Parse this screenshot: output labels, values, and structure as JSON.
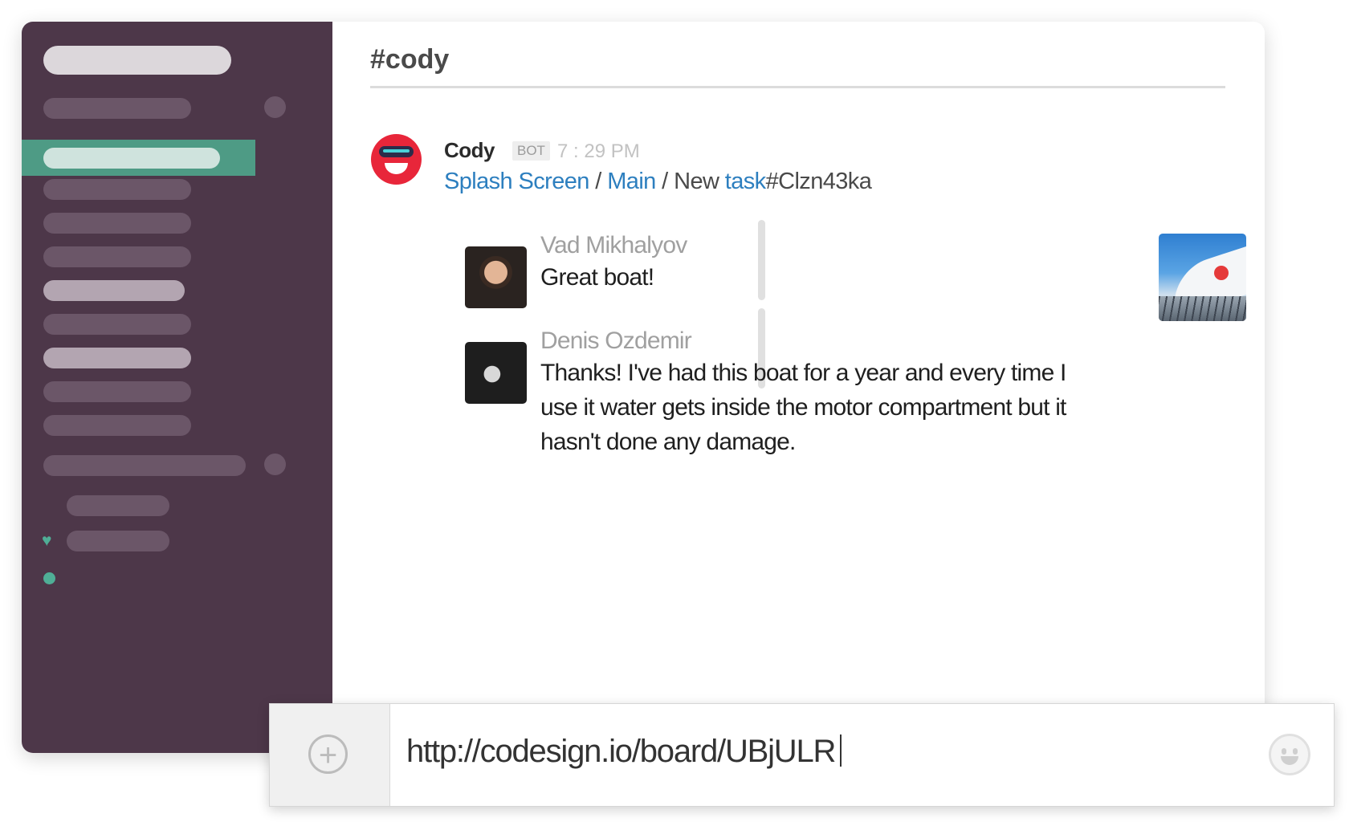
{
  "channel": {
    "name": "#cody"
  },
  "message": {
    "author": "Cody",
    "badge": "BOT",
    "time": "7 : 29 PM",
    "breadcrumb": {
      "link1": "Splash Screen",
      "sep1": "/",
      "link2": "Main",
      "sep2": "/",
      "plain": "New",
      "link3": "task",
      "task_id": "#Clzn43ka"
    },
    "replies": [
      {
        "name": "Vad Mikhalyov",
        "text": "Great boat!"
      },
      {
        "name": "Denis Ozdemir",
        "text_lines": [
          "Thanks! I've had this boat for a year and every time I",
          "use it water gets inside the motor compartment but it",
          "hasn't done any damage."
        ]
      }
    ]
  },
  "composer": {
    "value": "http://codesign.io/board/UBjULR"
  },
  "icons": {
    "add": "plus-circle-icon",
    "emoji": "smiley-icon",
    "favorite": "heart-icon",
    "presence": "online-dot-icon"
  },
  "colors": {
    "sidebar": "#4d3749",
    "active_item": "#4e9b85",
    "link": "#2d7fbf",
    "bot_avatar": "#e8263a"
  }
}
